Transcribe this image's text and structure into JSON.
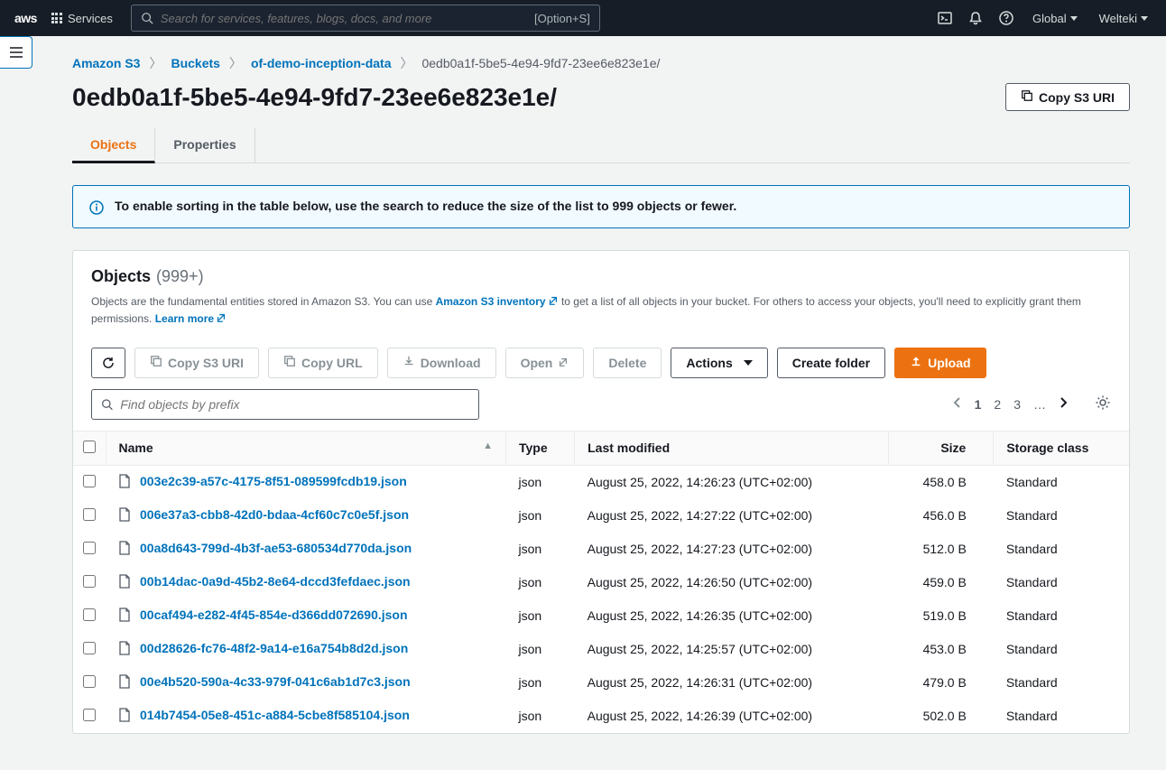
{
  "topnav": {
    "services_label": "Services",
    "search_placeholder": "Search for services, features, blogs, docs, and more",
    "search_shortcut": "[Option+S]",
    "region_label": "Global",
    "user_label": "Welteki"
  },
  "breadcrumb": {
    "items": [
      "Amazon S3",
      "Buckets",
      "of-demo-inception-data",
      "0edb0a1f-5be5-4e94-9fd7-23ee6e823e1e/"
    ]
  },
  "page_title": "0edb0a1f-5be5-4e94-9fd7-23ee6e823e1e/",
  "copy_uri_label": "Copy S3 URI",
  "tabs": {
    "objects": "Objects",
    "properties": "Properties"
  },
  "banner": {
    "message": "To enable sorting in the table below, use the search to reduce the size of the list to 999 objects or fewer."
  },
  "panel": {
    "title": "Objects",
    "count": "(999+)",
    "desc_pre": "Objects are the fundamental entities stored in Amazon S3. You can use ",
    "desc_link1": "Amazon S3 inventory",
    "desc_mid": " to get a list of all objects in your bucket. For others to access your objects, you'll need to explicitly grant them permissions. ",
    "desc_link2": "Learn more"
  },
  "toolbar": {
    "copy_uri": "Copy S3 URI",
    "copy_url": "Copy URL",
    "download": "Download",
    "open": "Open",
    "delete": "Delete",
    "actions": "Actions",
    "create_folder": "Create folder",
    "upload": "Upload",
    "find_placeholder": "Find objects by prefix"
  },
  "pagination": {
    "pages": [
      "1",
      "2",
      "3",
      "…"
    ]
  },
  "columns": {
    "name": "Name",
    "type": "Type",
    "last_modified": "Last modified",
    "size": "Size",
    "storage_class": "Storage class"
  },
  "rows": [
    {
      "name": "003e2c39-a57c-4175-8f51-089599fcdb19.json",
      "type": "json",
      "last_modified": "August 25, 2022, 14:26:23 (UTC+02:00)",
      "size": "458.0 B",
      "storage": "Standard"
    },
    {
      "name": "006e37a3-cbb8-42d0-bdaa-4cf60c7c0e5f.json",
      "type": "json",
      "last_modified": "August 25, 2022, 14:27:22 (UTC+02:00)",
      "size": "456.0 B",
      "storage": "Standard"
    },
    {
      "name": "00a8d643-799d-4b3f-ae53-680534d770da.json",
      "type": "json",
      "last_modified": "August 25, 2022, 14:27:23 (UTC+02:00)",
      "size": "512.0 B",
      "storage": "Standard"
    },
    {
      "name": "00b14dac-0a9d-45b2-8e64-dccd3fefdaec.json",
      "type": "json",
      "last_modified": "August 25, 2022, 14:26:50 (UTC+02:00)",
      "size": "459.0 B",
      "storage": "Standard"
    },
    {
      "name": "00caf494-e282-4f45-854e-d366dd072690.json",
      "type": "json",
      "last_modified": "August 25, 2022, 14:26:35 (UTC+02:00)",
      "size": "519.0 B",
      "storage": "Standard"
    },
    {
      "name": "00d28626-fc76-48f2-9a14-e16a754b8d2d.json",
      "type": "json",
      "last_modified": "August 25, 2022, 14:25:57 (UTC+02:00)",
      "size": "453.0 B",
      "storage": "Standard"
    },
    {
      "name": "00e4b520-590a-4c33-979f-041c6ab1d7c3.json",
      "type": "json",
      "last_modified": "August 25, 2022, 14:26:31 (UTC+02:00)",
      "size": "479.0 B",
      "storage": "Standard"
    },
    {
      "name": "014b7454-05e8-451c-a884-5cbe8f585104.json",
      "type": "json",
      "last_modified": "August 25, 2022, 14:26:39 (UTC+02:00)",
      "size": "502.0 B",
      "storage": "Standard"
    }
  ]
}
